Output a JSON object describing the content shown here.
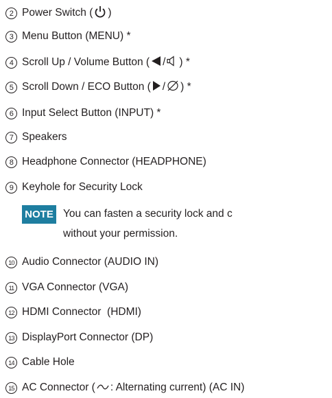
{
  "items": [
    {
      "num": "2",
      "label_before": "Power Switch (",
      "label_after": ")",
      "icon": "power-icon"
    },
    {
      "num": "3",
      "label": "Menu Button (MENU) *"
    },
    {
      "num": "4",
      "label_before": "Scroll Up / Volume Button (",
      "label_after": ") *",
      "icon": "left-triangle-volume-icon"
    },
    {
      "num": "5",
      "label_before": "Scroll Down / ECO Button (",
      "label_after": ") *",
      "icon": "right-triangle-eco-icon"
    },
    {
      "num": "6",
      "label": "Input Select Button (INPUT) *"
    },
    {
      "num": "7",
      "label": "Speakers"
    },
    {
      "num": "8",
      "label": "Headphone Connector (HEADPHONE)"
    },
    {
      "num": "9",
      "label": "Keyhole for Security Lock"
    },
    {
      "num": "10",
      "label": "Audio Connector (AUDIO IN)"
    },
    {
      "num": "11",
      "label": "VGA Connector (VGA)"
    },
    {
      "num": "12",
      "label": "HDMI Connector  (HDMI)"
    },
    {
      "num": "13",
      "label": "DisplayPort Connector (DP)"
    },
    {
      "num": "14",
      "label": "Cable Hole"
    },
    {
      "num": "15",
      "label_before": "AC Connector (",
      "label_after": ": Alternating current) (AC IN)",
      "icon": "tilde-icon"
    }
  ],
  "note": {
    "badge": "NOTE",
    "line1": "You can fasten a security lock and c",
    "line2": "without your permission."
  },
  "colors": {
    "note_badge": "#1e7ea0",
    "text": "#231f20"
  },
  "separators": {
    "slash": "/"
  }
}
